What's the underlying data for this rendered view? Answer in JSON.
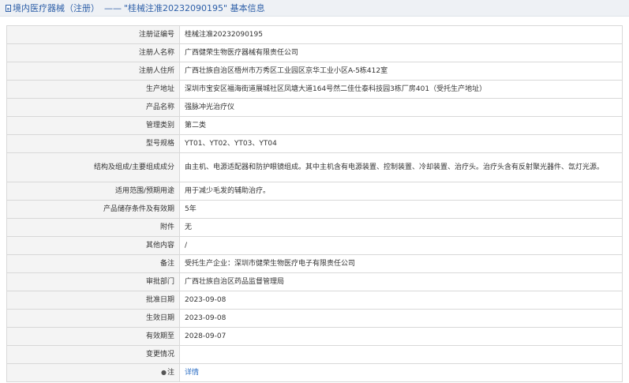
{
  "header": {
    "category": "境内医疗器械（注册）",
    "separator": "——",
    "title": "\"桂械注准20232090195\" 基本信息"
  },
  "rows": [
    {
      "label": "注册证编号",
      "value": "桂械注准20232090195"
    },
    {
      "label": "注册人名称",
      "value": "广西健荣生物医疗器械有限责任公司"
    },
    {
      "label": "注册人住所",
      "value": "广西壮族自治区梧州市万秀区工业园区京华工业小区A-5栋412室"
    },
    {
      "label": "生产地址",
      "value": "深圳市宝安区福海街道展城社区凤塘大道164号然二佳仕泰科技园3栋厂房401（受托生产地址）"
    },
    {
      "label": "产品名称",
      "value": "强脉冲光治疗仪"
    },
    {
      "label": "管理类别",
      "value": "第二类"
    },
    {
      "label": "型号规格",
      "value": "YT01、YT02、YT03、YT04"
    },
    {
      "label": "结构及组成/主要组成成分",
      "value": "由主机、电源适配器和防护眼镜组成。其中主机含有电源装置、控制装置、冷却装置、治疗头。治疗头含有反射聚光器件、氙灯光源。"
    },
    {
      "label": "适用范围/预期用途",
      "value": "用于减少毛发的辅助治疗。"
    },
    {
      "label": "产品储存条件及有效期",
      "value": "5年"
    },
    {
      "label": "附件",
      "value": "无"
    },
    {
      "label": "其他内容",
      "value": "/"
    },
    {
      "label": "备注",
      "value": "受托生产企业：深圳市健荣生物医疗电子有限责任公司"
    },
    {
      "label": "审批部门",
      "value": "广西壮族自治区药品监督管理局"
    },
    {
      "label": "批准日期",
      "value": "2023-09-08"
    },
    {
      "label": "生效日期",
      "value": "2023-09-08"
    },
    {
      "label": "有效期至",
      "value": "2028-09-07"
    },
    {
      "label": "变更情况",
      "value": ""
    }
  ],
  "note_row": {
    "label": "注",
    "link": "详情",
    "icon": "note-icon"
  }
}
